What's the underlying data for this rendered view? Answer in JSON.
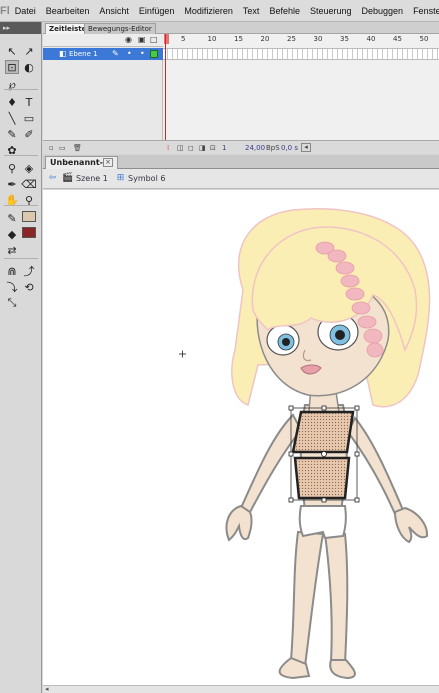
{
  "app": {
    "logo_text": "Fl",
    "menu": [
      "Datei",
      "Bearbeiten",
      "Ansicht",
      "Einfügen",
      "Modifizieren",
      "Text",
      "Befehle",
      "Steuerung",
      "Debuggen",
      "Fenster"
    ]
  },
  "tools": {
    "header": "▸▸",
    "items": [
      {
        "name": "selection-tool-icon",
        "glyph": "↖"
      },
      {
        "name": "subselection-tool-icon",
        "glyph": "↗"
      },
      {
        "name": "free-transform-tool-icon",
        "glyph": "⊡",
        "selected": true
      },
      {
        "name": "3d-rotation-tool-icon",
        "glyph": "◐"
      },
      {
        "name": "lasso-tool-icon",
        "glyph": "℘"
      },
      {
        "name": "pen-tool-icon",
        "glyph": "♦"
      },
      {
        "name": "text-tool-icon",
        "glyph": "T"
      },
      {
        "name": "line-tool-icon",
        "glyph": "╲"
      },
      {
        "name": "rectangle-tool-icon",
        "glyph": "▭"
      },
      {
        "name": "pencil-tool-icon",
        "glyph": "✎"
      },
      {
        "name": "brush-tool-icon",
        "glyph": "✐"
      },
      {
        "name": "deco-tool-icon",
        "glyph": "✿"
      },
      {
        "name": "bone-tool-icon",
        "glyph": "⚲"
      },
      {
        "name": "paint-bucket-tool-icon",
        "glyph": "◈"
      },
      {
        "name": "eyedropper-tool-icon",
        "glyph": "✒"
      },
      {
        "name": "eraser-tool-icon",
        "glyph": "⌫"
      },
      {
        "name": "hand-tool-icon",
        "glyph": "✋"
      },
      {
        "name": "zoom-tool-icon",
        "glyph": "⚲"
      },
      {
        "name": "stroke-color-icon",
        "glyph": "✎"
      },
      {
        "name": "fill-color-icon",
        "glyph": "◆"
      },
      {
        "name": "swap-colors-icon",
        "glyph": "⇄"
      },
      {
        "name": "snap-to-objects-icon",
        "glyph": "⋒"
      },
      {
        "name": "smooth-icon",
        "glyph": "⤴"
      },
      {
        "name": "straighten-icon",
        "glyph": "⤵"
      },
      {
        "name": "rotate-skew-icon",
        "glyph": "⟲"
      },
      {
        "name": "scale-icon",
        "glyph": "⤡"
      }
    ],
    "stroke_color": "#dcc8ac",
    "fill_color": "#8b2626"
  },
  "timeline": {
    "tabs": [
      "Zeitleiste",
      "Bewegungs-Editor"
    ],
    "ruler": [
      "5",
      "10",
      "15",
      "20",
      "25",
      "30",
      "35",
      "40",
      "45",
      "50"
    ],
    "layer_name": "Ebene 1",
    "status": {
      "frame": "1",
      "fps": "24,00",
      "fps_unit": "BpS",
      "time": "0,0 s"
    }
  },
  "document": {
    "tab_title": "Unbenannt-1*",
    "close": "×"
  },
  "editbar": {
    "scene": "Szene 1",
    "symbol": "Symbol 6"
  },
  "colors": {
    "hair": "#fbeeb4",
    "hair_outline": "#f0c4c4",
    "skin": "#f3e2cf",
    "outline": "#8b8b8b",
    "top_fill": "#e8c8ad",
    "eyes": "#7fbfe0",
    "lips": "#e8a0a8",
    "shorts": "#ffffff",
    "selection": "#333333",
    "accent_blue": "#3c79d6"
  }
}
